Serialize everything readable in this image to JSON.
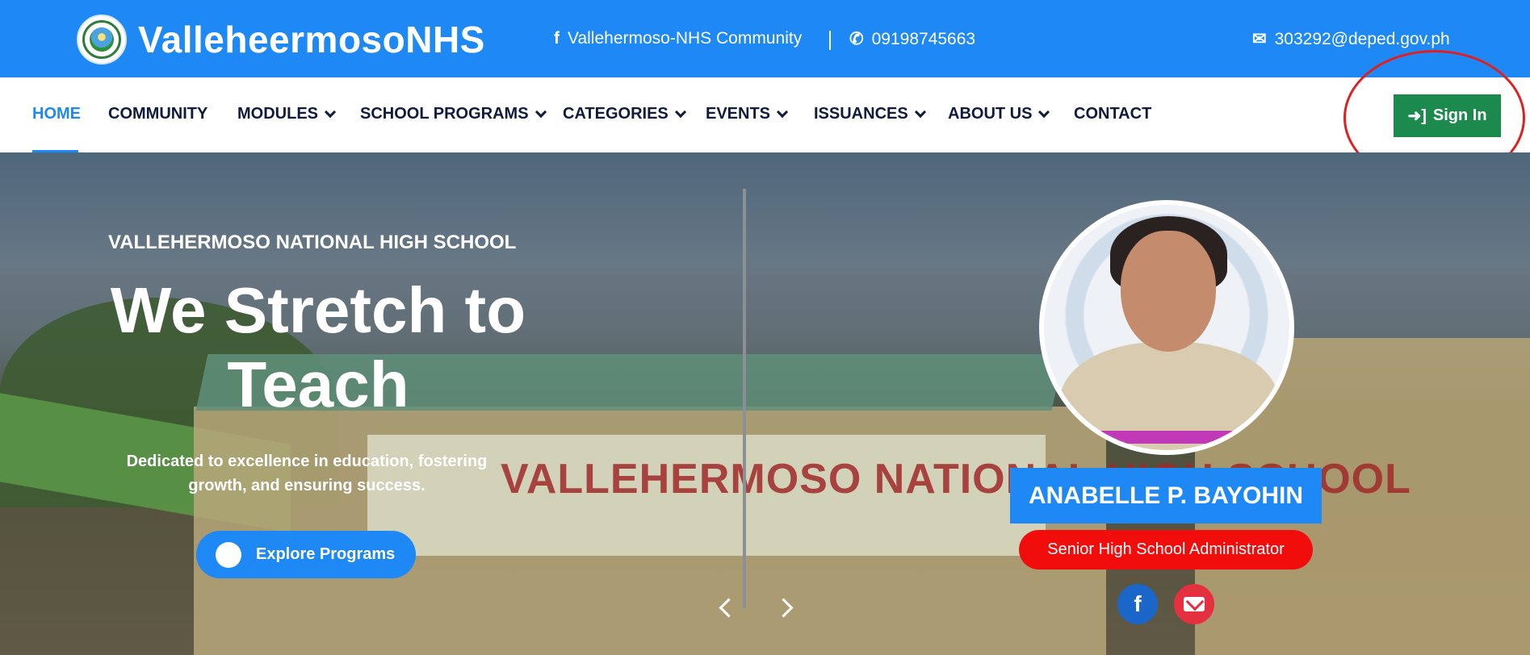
{
  "topbar": {
    "brand_name": "ValleheermosoNHS",
    "facebook": "Vallehermoso-NHS Community",
    "phone": "09198745663",
    "email": "303292@deped.gov.ph"
  },
  "nav": {
    "items": [
      {
        "label": "HOME",
        "active": true
      },
      {
        "label": "COMMUNITY"
      },
      {
        "label": "MODULES"
      },
      {
        "label": "SCHOOL PROGRAMS"
      },
      {
        "label": "CATEGORIES"
      },
      {
        "label": "EVENTS"
      },
      {
        "label": "ISSUANCES"
      },
      {
        "label": "ABOUT US"
      },
      {
        "label": "CONTACT"
      }
    ],
    "signin_label": "Sign In"
  },
  "hero": {
    "tagline": "VALLEHERMOSO NATIONAL HIGH SCHOOL",
    "headline": "We Stretch to Teach",
    "description": "Dedicated to excellence in education, fostering growth, and ensuring success.",
    "cta_label": "Explore Programs",
    "banner_text": "VALLEHERMOSO NATIONAL HIGH SCHOOL",
    "admin_name": "ANABELLE P. BAYOHIN",
    "admin_role": "Senior High School Administrator"
  },
  "colors": {
    "primary": "#1e88f5",
    "signin": "#1c8a4d",
    "role": "#f20d0d",
    "annotation": "#e02020"
  },
  "icons": [
    "facebook-icon",
    "phone-icon",
    "envelope-icon",
    "sign-in-icon",
    "chevron-down-icon",
    "chevron-left-icon",
    "chevron-right-icon"
  ]
}
